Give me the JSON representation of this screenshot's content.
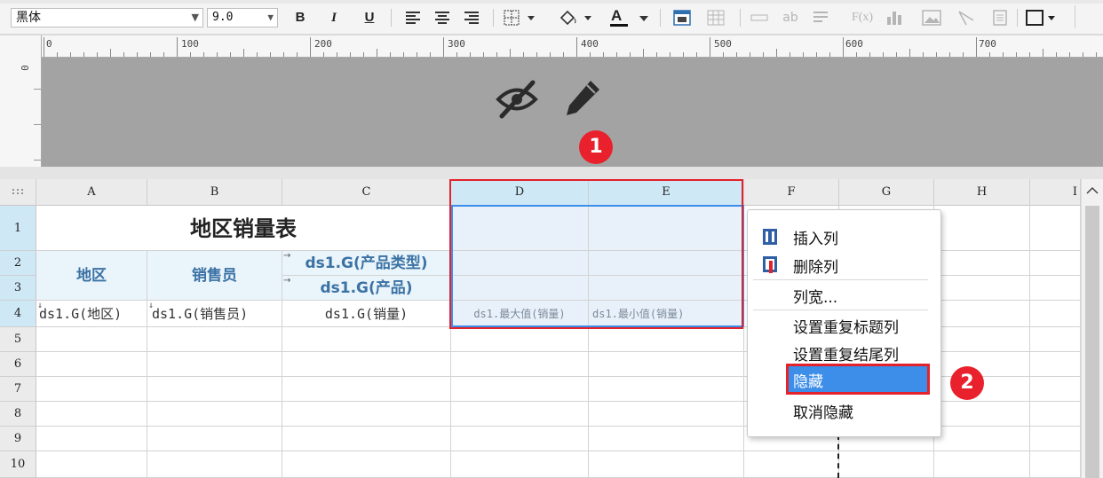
{
  "toolbar": {
    "font_name": "黑体",
    "font_size": "9.0",
    "bold": "B",
    "italic": "I",
    "underline": "U",
    "font_color_letter": "A",
    "text_icon": "ab",
    "formula_icon": "F(x)"
  },
  "ruler": {
    "h_labels": [
      "0",
      "100",
      "200",
      "300",
      "400",
      "500",
      "600",
      "700"
    ],
    "v_label": "0"
  },
  "columns": [
    "A",
    "B",
    "C",
    "D",
    "E",
    "F",
    "G",
    "H",
    "I"
  ],
  "rows": [
    "1",
    "2",
    "3",
    "4",
    "5",
    "6",
    "7",
    "8",
    "9",
    "10"
  ],
  "cells": {
    "title": "地区销量表",
    "region_header": "地区",
    "sales_header": "销售员",
    "product_type_header": "ds1.G(产品类型)",
    "product_header": "ds1.G(产品)",
    "region_data": "ds1.G(地区)",
    "sales_data": "ds1.G(销售员)",
    "qty_data": "ds1.G(销量)",
    "max_data": "ds1.最大值(销量)",
    "min_data": "ds1.最小值(销量)"
  },
  "context_menu": {
    "items": [
      "插入列",
      "删除列",
      "列宽...",
      "设置重复标题列",
      "设置重复结尾列",
      "隐藏",
      "取消隐藏"
    ],
    "highlighted": "隐藏"
  },
  "annotations": {
    "badge1": "1",
    "badge2": "2"
  },
  "colors": {
    "highlight": "#3d8ee9",
    "annotation_red": "#e8212c",
    "selection_border": "#e3222c"
  },
  "icons": [
    "hide-eye-icon",
    "pencil-icon",
    "insert-column-icon",
    "delete-column-icon"
  ]
}
